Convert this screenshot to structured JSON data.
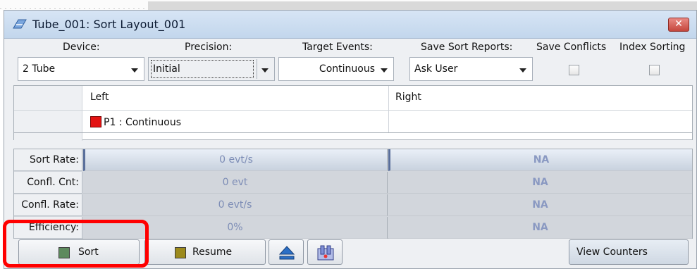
{
  "window": {
    "title": "Tube_001: Sort Layout_001",
    "close_symbol": "✕"
  },
  "headers": {
    "device": "Device:",
    "precision": "Precision:",
    "target_events": "Target Events:",
    "save_sort_reports": "Save Sort Reports:",
    "save_conflicts": "Save Conflicts",
    "index_sorting": "Index Sorting"
  },
  "controls": {
    "device_value": "2 Tube",
    "precision_value": "Initial",
    "target_events_value": "Continuous",
    "save_sort_reports_value": "Ask User",
    "save_conflicts_checked": false,
    "index_sorting_checked": false
  },
  "sort_grid": {
    "columns": [
      "Left",
      "Right"
    ],
    "rows": [
      {
        "left": "P1 : Continuous",
        "left_color": "#e31313",
        "right": ""
      }
    ]
  },
  "stats": {
    "rows": [
      {
        "label": "Sort Rate:",
        "left": "0 evt/s",
        "right": "NA"
      },
      {
        "label": "Confl. Cnt:",
        "left": "0 evt",
        "right": "NA"
      },
      {
        "label": "Confl. Rate:",
        "left": "0 evt/s",
        "right": "NA"
      },
      {
        "label": "Efficiency:",
        "left": "0%",
        "right": "NA"
      }
    ]
  },
  "toolbar": {
    "sort_label": "Sort",
    "resume_label": "Resume",
    "view_counters_label": "View Counters",
    "icons": [
      "sort-stop-icon",
      "resume-icon",
      "eject-icon",
      "tube-holder-icon"
    ]
  },
  "colors": {
    "highlight": "#ff0000",
    "title_bg": "#c2d6ec",
    "stat_value": "#7d8db6"
  }
}
